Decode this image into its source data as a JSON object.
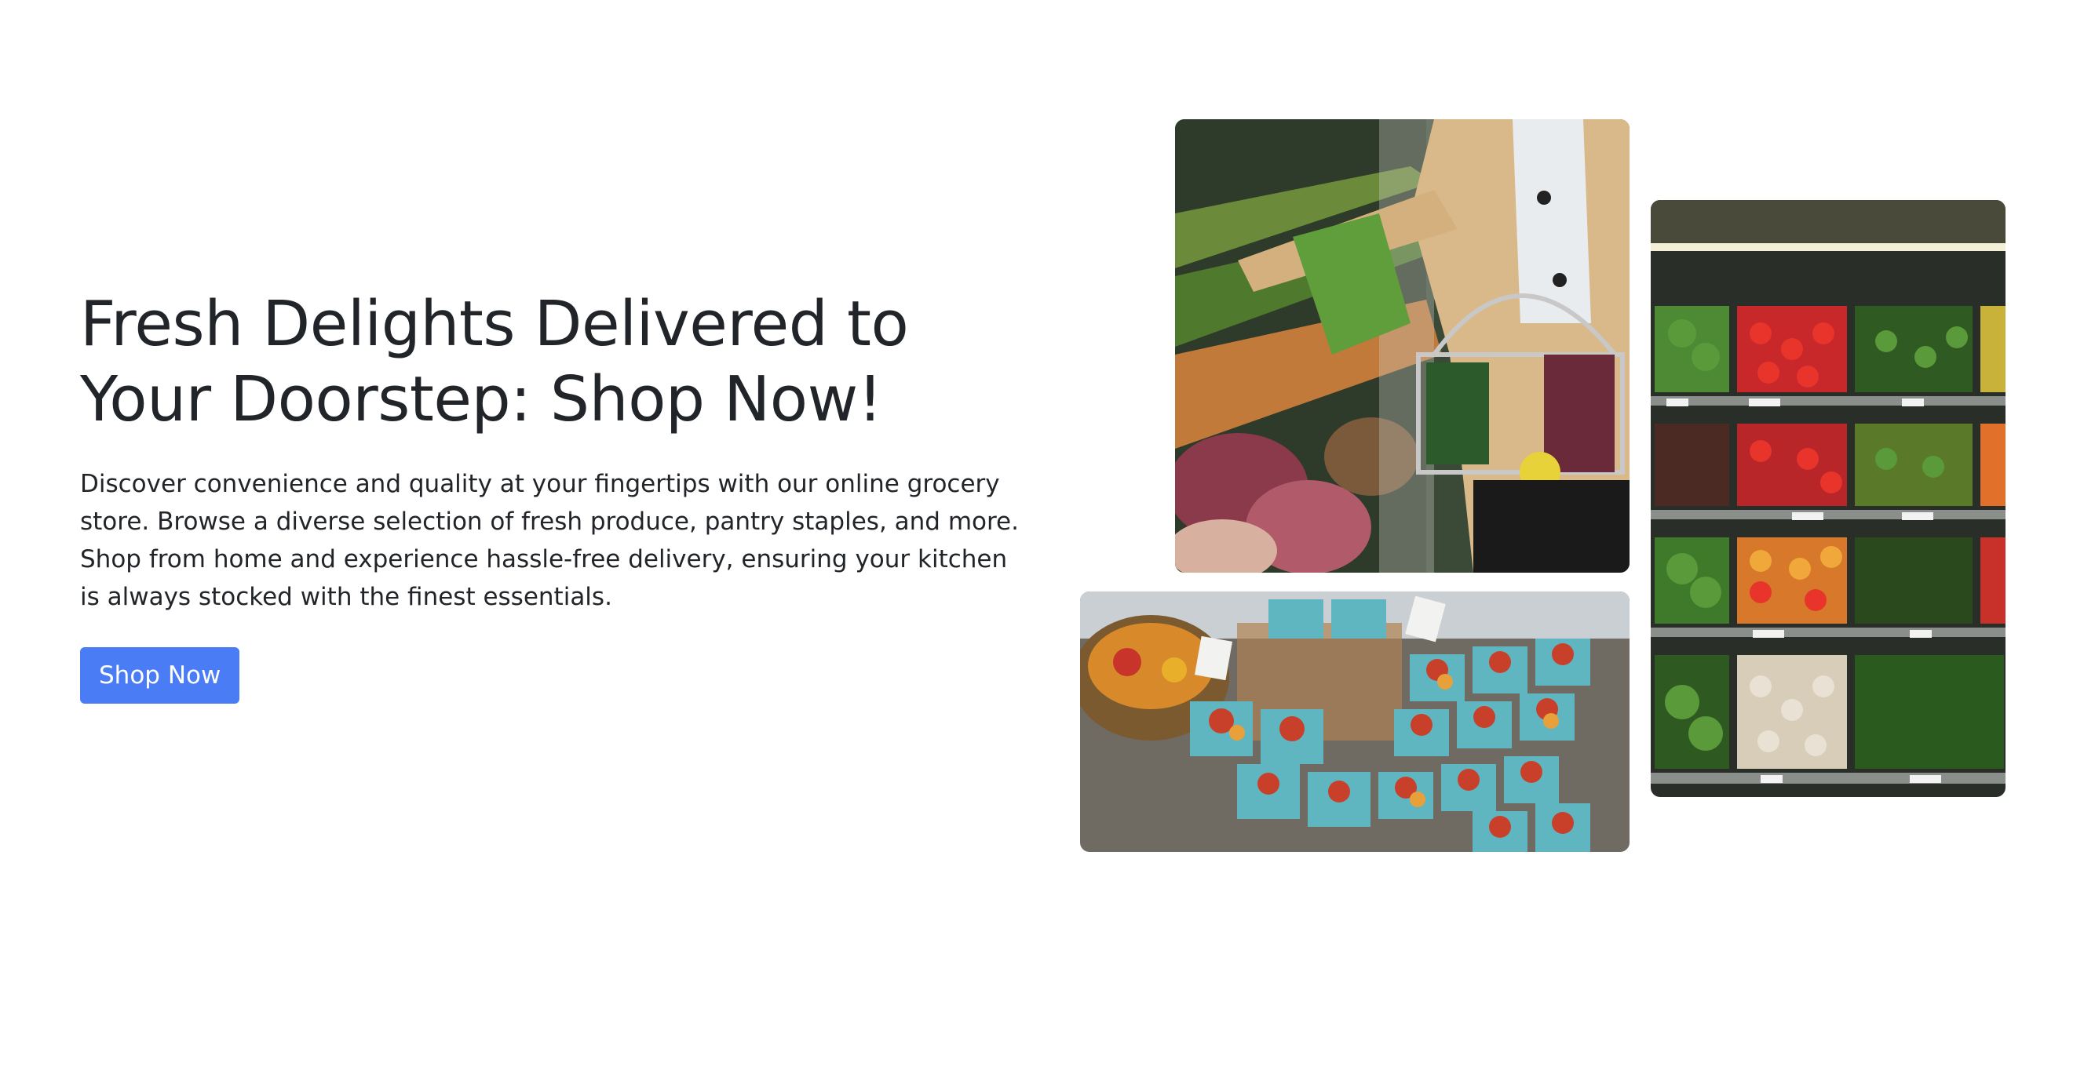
{
  "hero": {
    "title": "Fresh Delights Delivered to Your Doorstep: Shop Now!",
    "description": "Discover convenience and quality at your fingertips with our online grocery store. Browse a diverse selection of fresh produce, pantry staples, and more. Shop from home and experience hassle-free delivery, ensuring your kitchen is always stocked with the finest essentials.",
    "button_label": "Shop Now"
  },
  "colors": {
    "button": "#4a7df5",
    "text": "#212529",
    "background": "#ffffff"
  },
  "images": [
    {
      "name": "shopper-with-basket-photo",
      "alt": "Shopper holding a wire basket in the produce aisle"
    },
    {
      "name": "market-produce-photo",
      "alt": "Farmers market table with baskets of peppers and tomatoes"
    },
    {
      "name": "produce-shelves-photo",
      "alt": "Supermarket shelves stocked with peppers and vegetables"
    }
  ]
}
